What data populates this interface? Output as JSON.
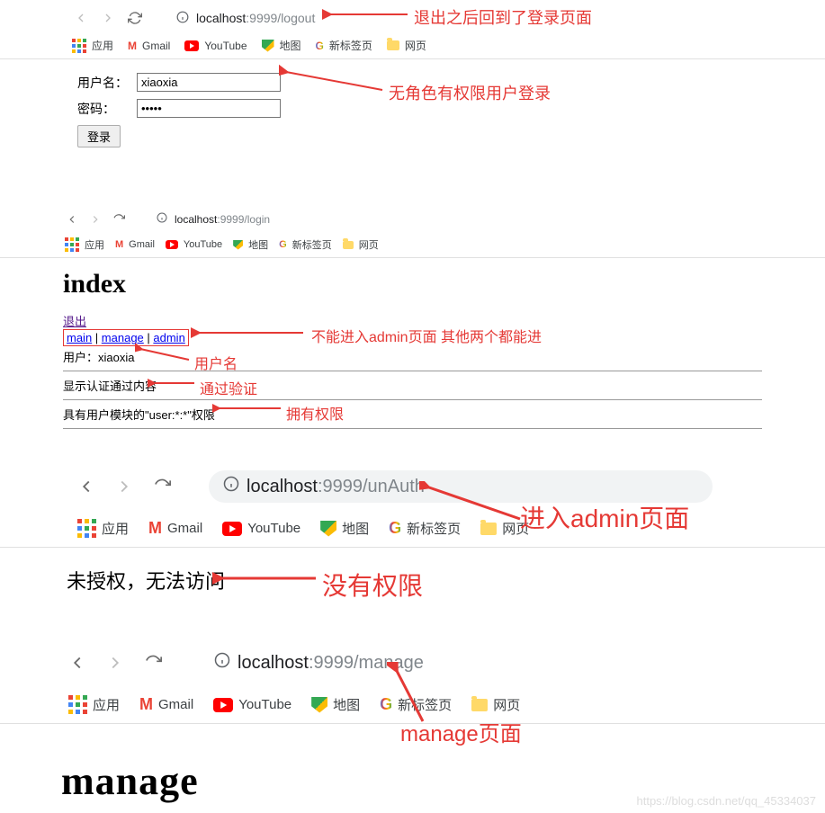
{
  "sec1": {
    "url_host": "localhost",
    "url_port_path": ":9999/logout",
    "bookmarks": {
      "apps": "应用",
      "gmail": "Gmail",
      "youtube": "YouTube",
      "maps": "地图",
      "newtab": "新标签页",
      "web": "网页"
    },
    "form": {
      "user_label": "用户名：",
      "pass_label": "密码：",
      "user_value": "xiaoxia",
      "pass_value": "•••••",
      "login_btn": "登录"
    },
    "anno1": "退出之后回到了登录页面",
    "anno2": "无角色有权限用户登录"
  },
  "sec2": {
    "url_host": "localhost",
    "url_port_path": ":9999/login",
    "bookmarks": {
      "apps": "应用",
      "gmail": "Gmail",
      "youtube": "YouTube",
      "maps": "地图",
      "newtab": "新标签页",
      "web": "网页"
    },
    "title": "index",
    "logout": "退出",
    "links": {
      "main": "main",
      "manage": "manage",
      "admin": "admin",
      "sep": " | "
    },
    "user_row_label": "用户：",
    "user_row_value": "xiaoxia",
    "auth_row": "显示认证通过内容",
    "perm_row": "具有用户模块的\"user:*:*\"权限",
    "anno_links": "不能进入admin页面 其他两个都能进",
    "anno_user": "用户名",
    "anno_auth": "通过验证",
    "anno_perm": "拥有权限"
  },
  "sec3": {
    "url_host": "localhost",
    "url_port_path": ":9999/unAuth",
    "bookmarks": {
      "apps": "应用",
      "gmail": "Gmail",
      "youtube": "YouTube",
      "maps": "地图",
      "newtab": "新标签页",
      "web": "网页"
    },
    "body": "未授权，无法访问",
    "anno_enter": "进入admin页面",
    "anno_noperm": "没有权限"
  },
  "sec4": {
    "url_host": "localhost",
    "url_port_path": ":9999/manage",
    "bookmarks": {
      "apps": "应用",
      "gmail": "Gmail",
      "youtube": "YouTube",
      "maps": "地图",
      "newtab": "新标签页",
      "web": "网页"
    },
    "title": "manage",
    "anno": "manage页面"
  },
  "watermark": "https://blog.csdn.net/qq_45334037"
}
